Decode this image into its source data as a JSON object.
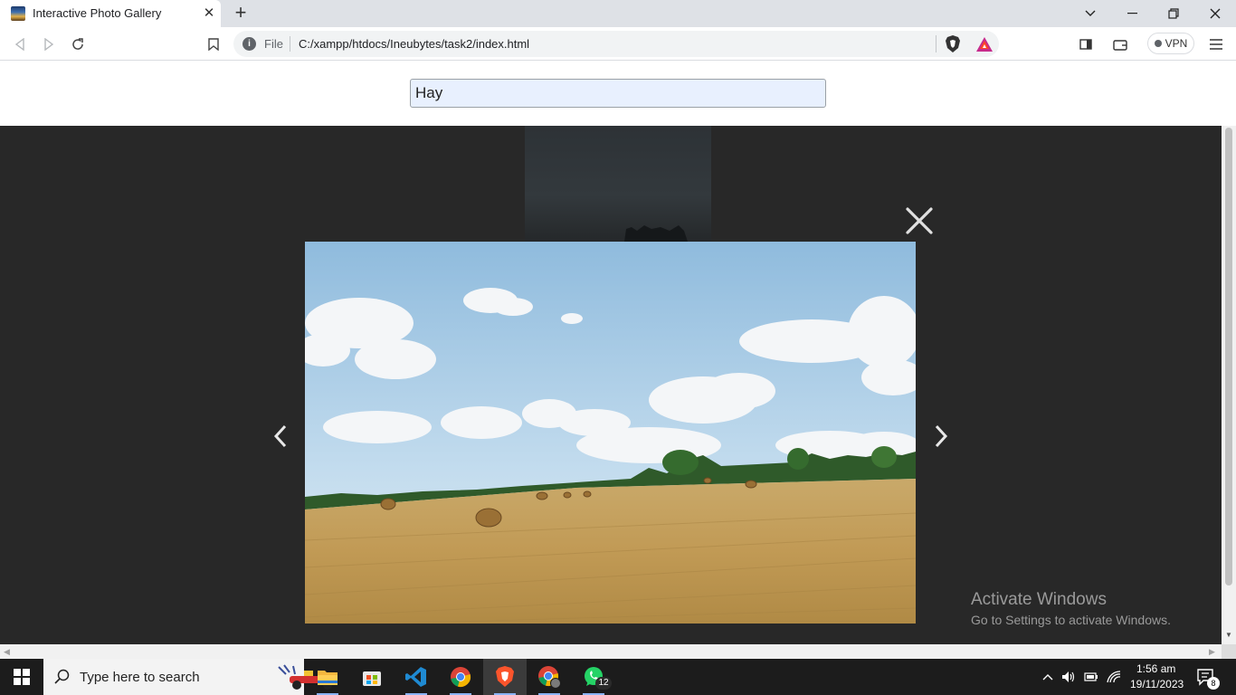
{
  "browser": {
    "tab_title": "Interactive Photo Gallery",
    "address_scheme": "File",
    "address_url": "C:/xampp/htdocs/Ineubytes/task2/index.html",
    "vpn_label": "VPN",
    "icons": [
      "back-icon",
      "forward-icon",
      "reload-icon",
      "bookmark-icon",
      "site-info-icon",
      "brave-shields-icon",
      "brave-rewards-icon",
      "sidebar-icon",
      "wallet-icon",
      "menu-icon"
    ]
  },
  "gallery": {
    "search_value": "Hay",
    "lightbox_image": "hay-bales-field",
    "icons": [
      "close-icon",
      "prev-arrow-icon",
      "next-arrow-icon"
    ]
  },
  "watermark": {
    "title": "Activate Windows",
    "subtitle": "Go to Settings to activate Windows."
  },
  "taskbar": {
    "search_placeholder": "Type here to search",
    "apps": [
      "file-explorer",
      "microsoft-store",
      "vs-code",
      "chrome",
      "brave",
      "chrome-profile",
      "whatsapp"
    ],
    "whatsapp_badge": "12",
    "time": "1:56 am",
    "date": "19/11/2023",
    "notification_count": "8"
  },
  "colors": {
    "lightbox_bg": "#282828",
    "search_bg": "#e8f0fe",
    "taskbar_bg": "#1c1c1c",
    "brave_orange": "#fb542b"
  }
}
